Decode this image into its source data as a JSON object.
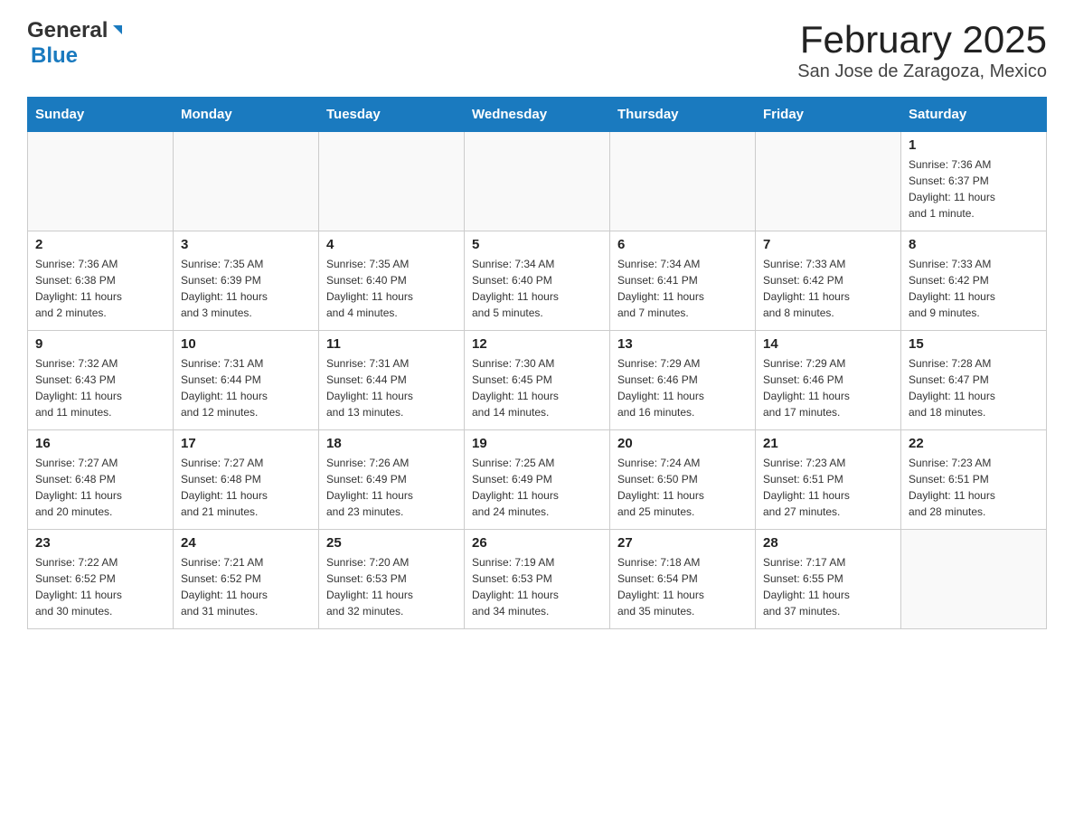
{
  "header": {
    "logo_general": "General",
    "logo_blue": "Blue",
    "title": "February 2025",
    "subtitle": "San Jose de Zaragoza, Mexico"
  },
  "days_of_week": [
    "Sunday",
    "Monday",
    "Tuesday",
    "Wednesday",
    "Thursday",
    "Friday",
    "Saturday"
  ],
  "weeks": [
    [
      {
        "day": "",
        "info": ""
      },
      {
        "day": "",
        "info": ""
      },
      {
        "day": "",
        "info": ""
      },
      {
        "day": "",
        "info": ""
      },
      {
        "day": "",
        "info": ""
      },
      {
        "day": "",
        "info": ""
      },
      {
        "day": "1",
        "info": "Sunrise: 7:36 AM\nSunset: 6:37 PM\nDaylight: 11 hours\nand 1 minute."
      }
    ],
    [
      {
        "day": "2",
        "info": "Sunrise: 7:36 AM\nSunset: 6:38 PM\nDaylight: 11 hours\nand 2 minutes."
      },
      {
        "day": "3",
        "info": "Sunrise: 7:35 AM\nSunset: 6:39 PM\nDaylight: 11 hours\nand 3 minutes."
      },
      {
        "day": "4",
        "info": "Sunrise: 7:35 AM\nSunset: 6:40 PM\nDaylight: 11 hours\nand 4 minutes."
      },
      {
        "day": "5",
        "info": "Sunrise: 7:34 AM\nSunset: 6:40 PM\nDaylight: 11 hours\nand 5 minutes."
      },
      {
        "day": "6",
        "info": "Sunrise: 7:34 AM\nSunset: 6:41 PM\nDaylight: 11 hours\nand 7 minutes."
      },
      {
        "day": "7",
        "info": "Sunrise: 7:33 AM\nSunset: 6:42 PM\nDaylight: 11 hours\nand 8 minutes."
      },
      {
        "day": "8",
        "info": "Sunrise: 7:33 AM\nSunset: 6:42 PM\nDaylight: 11 hours\nand 9 minutes."
      }
    ],
    [
      {
        "day": "9",
        "info": "Sunrise: 7:32 AM\nSunset: 6:43 PM\nDaylight: 11 hours\nand 11 minutes."
      },
      {
        "day": "10",
        "info": "Sunrise: 7:31 AM\nSunset: 6:44 PM\nDaylight: 11 hours\nand 12 minutes."
      },
      {
        "day": "11",
        "info": "Sunrise: 7:31 AM\nSunset: 6:44 PM\nDaylight: 11 hours\nand 13 minutes."
      },
      {
        "day": "12",
        "info": "Sunrise: 7:30 AM\nSunset: 6:45 PM\nDaylight: 11 hours\nand 14 minutes."
      },
      {
        "day": "13",
        "info": "Sunrise: 7:29 AM\nSunset: 6:46 PM\nDaylight: 11 hours\nand 16 minutes."
      },
      {
        "day": "14",
        "info": "Sunrise: 7:29 AM\nSunset: 6:46 PM\nDaylight: 11 hours\nand 17 minutes."
      },
      {
        "day": "15",
        "info": "Sunrise: 7:28 AM\nSunset: 6:47 PM\nDaylight: 11 hours\nand 18 minutes."
      }
    ],
    [
      {
        "day": "16",
        "info": "Sunrise: 7:27 AM\nSunset: 6:48 PM\nDaylight: 11 hours\nand 20 minutes."
      },
      {
        "day": "17",
        "info": "Sunrise: 7:27 AM\nSunset: 6:48 PM\nDaylight: 11 hours\nand 21 minutes."
      },
      {
        "day": "18",
        "info": "Sunrise: 7:26 AM\nSunset: 6:49 PM\nDaylight: 11 hours\nand 23 minutes."
      },
      {
        "day": "19",
        "info": "Sunrise: 7:25 AM\nSunset: 6:49 PM\nDaylight: 11 hours\nand 24 minutes."
      },
      {
        "day": "20",
        "info": "Sunrise: 7:24 AM\nSunset: 6:50 PM\nDaylight: 11 hours\nand 25 minutes."
      },
      {
        "day": "21",
        "info": "Sunrise: 7:23 AM\nSunset: 6:51 PM\nDaylight: 11 hours\nand 27 minutes."
      },
      {
        "day": "22",
        "info": "Sunrise: 7:23 AM\nSunset: 6:51 PM\nDaylight: 11 hours\nand 28 minutes."
      }
    ],
    [
      {
        "day": "23",
        "info": "Sunrise: 7:22 AM\nSunset: 6:52 PM\nDaylight: 11 hours\nand 30 minutes."
      },
      {
        "day": "24",
        "info": "Sunrise: 7:21 AM\nSunset: 6:52 PM\nDaylight: 11 hours\nand 31 minutes."
      },
      {
        "day": "25",
        "info": "Sunrise: 7:20 AM\nSunset: 6:53 PM\nDaylight: 11 hours\nand 32 minutes."
      },
      {
        "day": "26",
        "info": "Sunrise: 7:19 AM\nSunset: 6:53 PM\nDaylight: 11 hours\nand 34 minutes."
      },
      {
        "day": "27",
        "info": "Sunrise: 7:18 AM\nSunset: 6:54 PM\nDaylight: 11 hours\nand 35 minutes."
      },
      {
        "day": "28",
        "info": "Sunrise: 7:17 AM\nSunset: 6:55 PM\nDaylight: 11 hours\nand 37 minutes."
      },
      {
        "day": "",
        "info": ""
      }
    ]
  ]
}
